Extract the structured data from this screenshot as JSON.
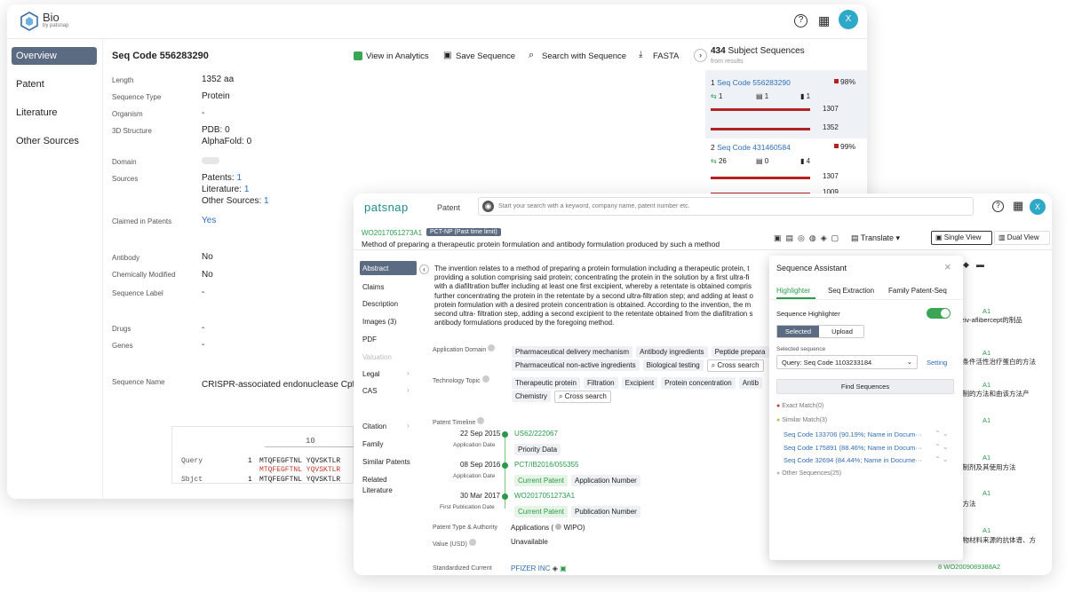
{
  "bio": {
    "logo_name": "Bio",
    "logo_sub": "by patsnap",
    "avatar": "X",
    "nav": [
      "Overview",
      "Patent",
      "Literature",
      "Other Sources"
    ],
    "title": "Seq Code 556283290",
    "toolbar": {
      "analytics": "View in Analytics",
      "save": "Save Sequence",
      "search": "Search with Sequence",
      "fasta": "FASTA"
    },
    "fields": {
      "length_l": "Length",
      "length_v": "1352 aa",
      "type_l": "Sequence Type",
      "type_v": "Protein",
      "org_l": "Organism",
      "org_v": "-",
      "struct_l": "3D Structure",
      "struct_v1": "PDB: 0",
      "struct_v2": "AlphaFold: 0",
      "domain_l": "Domain",
      "src_l": "Sources",
      "src_pat": "Patents:",
      "src_pat_n": "1",
      "src_lit": "Literature:",
      "src_lit_n": "1",
      "src_oth": "Other Sources:",
      "src_oth_n": "1",
      "claim_l": "Claimed in Patents",
      "claim_v": "Yes",
      "anti_l": "Antibody",
      "anti_v": "No",
      "chem_l": "Chemically Modified",
      "chem_v": "No",
      "label_l": "Sequence Label",
      "label_v": "-",
      "drugs_l": "Drugs",
      "drugs_v": "-",
      "genes_l": "Genes",
      "genes_v": "-",
      "name_l": "Sequence Name",
      "name_v": "CRISPR-associated endonuclease Cpf1"
    },
    "align": {
      "tick": "10",
      "q_l": "Query",
      "q_n": "1",
      "q_s": "MTQFEGFTNL YQVSKTLR",
      "m_s": "MTQFEGFTNL YQVSKTLR",
      "s_l": "Sbjct",
      "s_n": "1",
      "s_s": "MTQFEGFTNL YQVSKTLR"
    },
    "subjects": {
      "count": "434",
      "title": "Subject Sequences",
      "subtitle": "from results",
      "items": [
        {
          "idx": "1",
          "code": "Seq Code 556283290",
          "pct": "98%",
          "a": "1",
          "b": "1",
          "c": "1",
          "n1": "1307",
          "n2": "1352"
        },
        {
          "idx": "2",
          "code": "Seq Code 431460584",
          "pct": "99%",
          "a": "26",
          "b": "0",
          "c": "4",
          "n1": "1307",
          "n2": "1009"
        }
      ]
    }
  },
  "pat": {
    "logo": "patsnap",
    "tab": "Patent",
    "avatar": "X",
    "search_ph": "Start your search with a keyword, company name, patent number etc.",
    "pubno": "WO2017051273A1",
    "badge": "PCT-NP (Past time limit)",
    "title": "Method of preparing a therapeutic protein formulation and antibody formulation produced by such a method",
    "translate": "Translate",
    "single": "Single View",
    "dual": "Dual View",
    "nav": [
      "Abstract",
      "Claims",
      "Description",
      "Images (3)",
      "PDF",
      "Valuation",
      "Legal",
      "CAS",
      "Citation",
      "Family",
      "Similar Patents",
      "Related",
      "Literature"
    ],
    "abstract": [
      "The invention relates to a method of preparing a protein formulation including a therapeutic protein, t",
      "providing a solution comprising said protein; concentrating the protein in the solution by a first ultra-fi",
      "with a diafiltration buffer including at least one first excipient, whereby a retentate is obtained compris",
      "further concentrating the protein in the retentate by a second ultra-filtration step; and adding at least o",
      "protein formulation with a desired protein concentration is obtained. According to the invention, the m",
      "second ultra- filtration step, adding a second excipient to the retentate obtained from the diafiltration s",
      "antibody formulations produced by the foregoing method."
    ],
    "app_domain_l": "Application Domain",
    "app_domain": [
      "Pharmaceutical delivery mechanism",
      "Antibody ingredients",
      "Peptide prepara"
    ],
    "app_domain2": [
      "Pharmaceutical non-active ingredients",
      "Biological testing"
    ],
    "cross": "Cross search",
    "tech_l": "Technology Topic",
    "tech": [
      "Therapeutic protein",
      "Filtration",
      "Excipient",
      "Protein concentration",
      "Antib"
    ],
    "tech2": [
      "Chemistry"
    ],
    "timeline_l": "Patent Timeline",
    "timeline": [
      {
        "date": "22 Sep 2015",
        "dl": "Application Date",
        "no": "US62/222067",
        "t1": "Priority Data",
        "t2": ""
      },
      {
        "date": "08 Sep 2016",
        "dl": "Application Date",
        "no": "PCT/IB2016/055355",
        "t1": "Current Patent",
        "t2": "Application Number"
      },
      {
        "date": "30 Mar 2017",
        "dl": "First Publication Date",
        "no": "WO2017051273A1",
        "t1": "Current Patent",
        "t2": "Publication Number"
      }
    ],
    "ptype_l": "Patent Type & Authority",
    "ptype_v": "Applications (",
    "ptype_v2": "WIPO)",
    "value_l": "Value (USD)",
    "value_v": "Unavailable",
    "std_l": "Standardized Current",
    "std_v": "PFIZER INC",
    "right_items": [
      "ziv-aflibercept的制品",
      "发条件活性治疗蛋白的方法",
      "剂制的方法和由该方法产",
      "白",
      "质制剂及其使用方法",
      "备方法",
      "生物材料来源的抗体谱、方"
    ],
    "right_codes": [
      "A1",
      "A1",
      "A1",
      "A1",
      "A1",
      "A1",
      "A1"
    ],
    "right_last": "WO2009089388A2"
  },
  "sa": {
    "title": "Sequence Assistant",
    "tabs": [
      "Highlighter",
      "Seq Extraction",
      "Family Patent-Seq"
    ],
    "highlighter": "Sequence Highlighter",
    "selected": "Selected",
    "upload": "Upload",
    "sel_seq_l": "Selected sequence",
    "query": "Query: Seq Code 1103233184",
    "setting": "Setting",
    "find": "Find Sequences",
    "exact": "Exact Match(0)",
    "similar": "Similar Match(3)",
    "matches": [
      "Seq Code 133706 (90.19%; Name in Docum···",
      "Seq Code 175891 (88.46%; Name in Docum···",
      "Seq Code 32694 (84.44%; Name in Docume···"
    ],
    "other": "Other Sequences(25)"
  }
}
